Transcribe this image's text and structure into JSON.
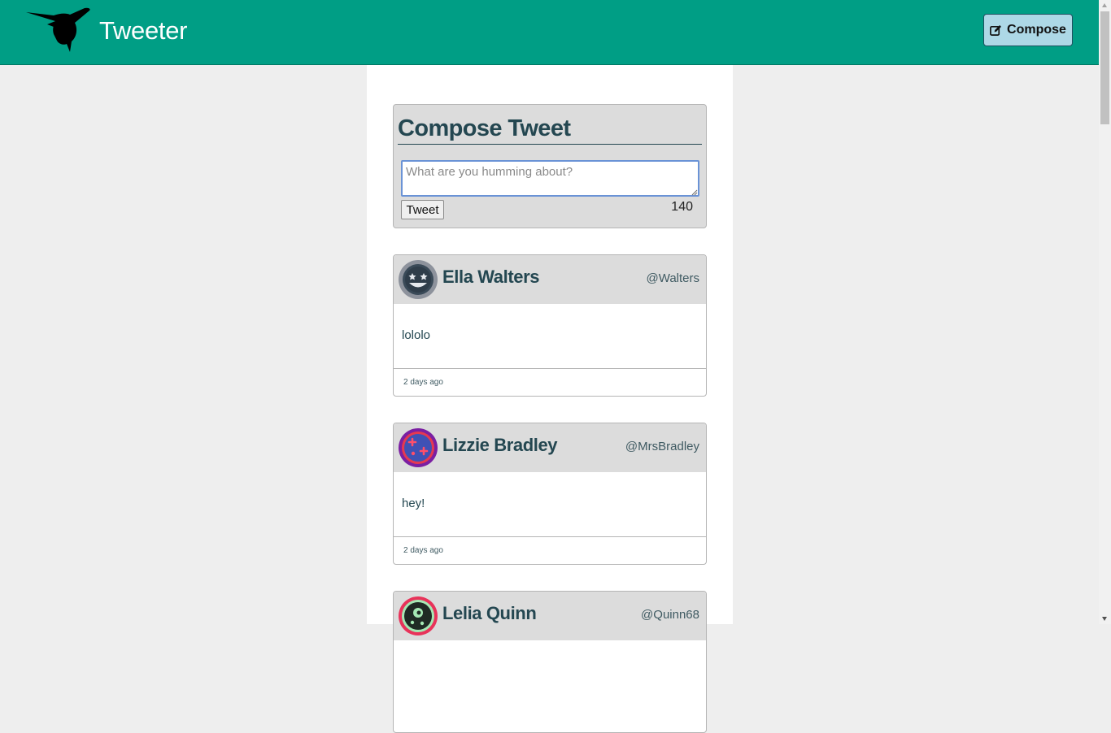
{
  "app": {
    "brand_name": "Tweeter",
    "compose_button_label": "Compose",
    "accent_color": "#009e85"
  },
  "compose": {
    "title": "Compose Tweet",
    "placeholder": "What are you humming about?",
    "value": "",
    "submit_label": "Tweet",
    "char_counter": "140"
  },
  "tweets": [
    {
      "name": "Ella Walters",
      "handle": "@Walters",
      "content": "lololo",
      "time": "2 days ago",
      "avatar_icon": "star-eyes-face-icon"
    },
    {
      "name": "Lizzie Bradley",
      "handle": "@MrsBradley",
      "content": "hey!",
      "time": "2 days ago",
      "avatar_icon": "game-controller-face-icon"
    },
    {
      "name": "Lelia Quinn",
      "handle": "@Quinn68",
      "content": "",
      "time": "",
      "avatar_icon": "alien-face-icon"
    }
  ]
}
